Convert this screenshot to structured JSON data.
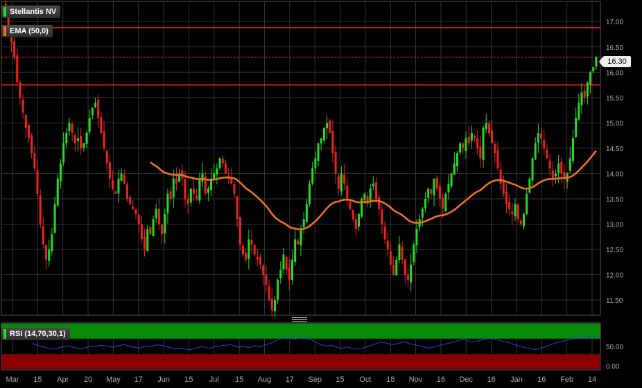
{
  "header": {
    "instrument": "Stellantis NV",
    "indicator": "EMA (50,0)",
    "rsi_label": "RSI (14,70,30,1)",
    "last_price": "16.30"
  },
  "colors": {
    "bull": "#22dd22",
    "bear": "#ee2222",
    "ema": "#f07020",
    "hline": "#ff2020",
    "rsi_line": "#2244ee",
    "overbought_zone": "#0a8a0a",
    "oversold_zone": "#8a0000",
    "grid": "#333333"
  },
  "chart_data": [
    {
      "type": "candlestick",
      "title": "Stellantis NV",
      "ylim": [
        11.2,
        17.4
      ],
      "y_ticks": [
        "11.50",
        "12.00",
        "12.50",
        "13.00",
        "13.50",
        "14.00",
        "14.50",
        "15.00",
        "15.50",
        "16.00",
        "16.50",
        "17.00"
      ],
      "x_ticks": [
        "Mar",
        "15",
        "Apr",
        "20",
        "May",
        "17",
        "Jun",
        "15",
        "Jul",
        "15",
        "Aug",
        "17",
        "Sep",
        "15",
        "Oct",
        "18",
        "Nov",
        "16",
        "Dec",
        "16",
        "Jan",
        "16",
        "Feb",
        "14"
      ],
      "closes": [
        17.2,
        16.9,
        16.6,
        16.3,
        15.8,
        15.5,
        15.2,
        14.9,
        14.7,
        14.4,
        14.1,
        13.6,
        13.0,
        12.6,
        12.3,
        12.5,
        12.8,
        13.4,
        13.9,
        14.2,
        14.6,
        14.8,
        15.0,
        14.8,
        14.6,
        14.7,
        14.5,
        14.6,
        14.8,
        15.1,
        15.3,
        15.4,
        15.1,
        14.8,
        14.5,
        14.2,
        13.9,
        13.7,
        13.6,
        13.9,
        14.0,
        13.8,
        13.5,
        13.4,
        13.3,
        13.2,
        13.0,
        12.7,
        12.5,
        12.9,
        12.8,
        13.1,
        13.3,
        13.0,
        12.8,
        13.2,
        13.6,
        13.5,
        13.9,
        13.8,
        14.0,
        13.9,
        13.5,
        13.4,
        13.7,
        13.6,
        13.5,
        13.9,
        14.0,
        13.6,
        13.7,
        13.9,
        14.0,
        14.1,
        14.3,
        14.2,
        14.0,
        13.9,
        13.8,
        13.6,
        13.1,
        12.6,
        12.4,
        12.3,
        12.7,
        12.6,
        12.4,
        12.3,
        12.2,
        12.0,
        11.8,
        11.5,
        11.3,
        11.5,
        11.9,
        12.1,
        12.4,
        12.1,
        11.9,
        12.3,
        12.7,
        12.6,
        12.9,
        13.1,
        13.4,
        13.8,
        14.1,
        14.3,
        14.6,
        14.7,
        14.9,
        15.0,
        14.8,
        14.4,
        14.0,
        13.7,
        14.0,
        13.8,
        13.5,
        13.3,
        13.1,
        12.9,
        13.2,
        13.5,
        13.6,
        13.4,
        13.7,
        13.8,
        13.5,
        13.3,
        13.0,
        12.7,
        12.5,
        12.2,
        12.0,
        12.3,
        12.6,
        12.3,
        12.0,
        11.9,
        12.2,
        12.6,
        12.9,
        13.1,
        13.3,
        13.5,
        13.7,
        13.6,
        13.9,
        13.7,
        13.5,
        13.3,
        13.6,
        13.8,
        14.0,
        14.2,
        14.4,
        14.6,
        14.5,
        14.7,
        14.6,
        14.8,
        14.7,
        14.5,
        14.3,
        14.9,
        15.0,
        14.8,
        14.6,
        14.4,
        14.1,
        13.8,
        13.6,
        13.4,
        13.3,
        13.2,
        13.4,
        13.1,
        13.0,
        13.2,
        13.6,
        13.9,
        14.3,
        14.6,
        14.8,
        14.7,
        14.5,
        14.3,
        14.1,
        13.9,
        14.0,
        14.2,
        14.0,
        13.9,
        14.0,
        14.3,
        14.7,
        15.1,
        15.4,
        15.6,
        15.5,
        15.8,
        16.0,
        16.1,
        16.3
      ]
    },
    {
      "type": "line",
      "title": "RSI (14,70,30,1)",
      "ylim": [
        0,
        100
      ],
      "y_ticks": [
        "0.00",
        "50.00"
      ],
      "values": [
        58,
        55,
        52,
        50,
        48,
        45,
        44,
        43,
        46,
        48,
        50,
        52,
        49,
        47,
        45,
        44,
        46,
        48,
        50,
        49,
        51,
        53,
        52,
        50,
        49,
        48,
        51,
        53,
        55,
        52,
        50,
        48,
        47,
        46,
        49,
        51,
        50,
        52,
        54,
        53,
        51,
        49,
        47,
        45,
        44,
        46,
        45,
        43,
        41,
        44,
        46,
        48,
        50,
        47,
        45,
        48,
        51,
        50,
        53,
        52,
        55,
        53,
        50,
        48,
        51,
        49,
        47,
        50,
        52,
        49,
        51,
        54,
        57,
        60,
        64,
        68,
        71,
        73,
        72,
        70,
        69,
        71,
        73,
        72,
        70,
        67,
        63,
        58,
        54,
        52,
        51,
        53,
        50,
        47,
        45,
        47,
        49,
        46,
        44,
        43,
        45,
        47,
        50,
        52,
        55,
        58,
        61,
        60,
        58,
        56,
        55,
        57,
        59,
        62,
        60,
        57,
        55,
        53,
        51,
        49,
        47,
        46,
        48,
        50,
        53,
        55,
        57,
        59,
        62,
        64,
        66,
        68,
        66,
        63,
        61,
        63,
        65,
        67,
        69,
        71,
        70,
        68,
        66,
        64,
        62,
        60,
        57,
        54,
        51,
        49,
        47,
        45,
        43,
        42,
        44,
        46,
        49,
        52,
        55,
        58,
        61,
        63,
        65,
        67,
        69,
        71,
        72,
        70,
        73,
        75,
        74,
        72,
        70
      ],
      "overbought": 70,
      "oversold": 30
    }
  ]
}
